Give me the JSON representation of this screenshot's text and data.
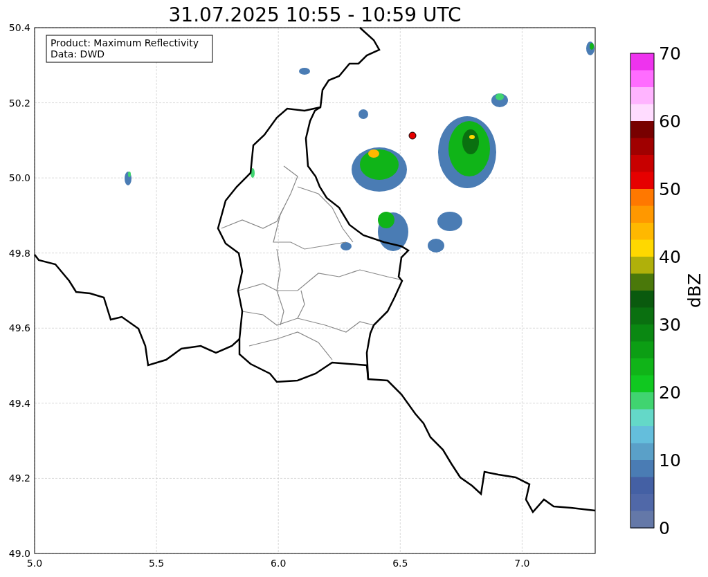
{
  "title": "31.07.2025 10:55 - 10:59 UTC",
  "info_box": {
    "lines": [
      "Product: Maximum Reflectivity",
      "Data: DWD"
    ]
  },
  "axes": {
    "xticks": [
      "5.0",
      "5.5",
      "6.0",
      "6.5",
      "7.0"
    ],
    "yticks": [
      "50.4",
      "50.2",
      "50.0",
      "49.8",
      "49.6",
      "49.4",
      "49.2",
      "49.0"
    ]
  },
  "colorbar": {
    "label": "dBZ",
    "ticks": [
      "70",
      "60",
      "50",
      "40",
      "30",
      "20",
      "10",
      "0"
    ],
    "bins": [
      {
        "color": "#ee33ee"
      },
      {
        "color": "#ff6cff"
      },
      {
        "color": "#ffb4ff"
      },
      {
        "color": "#ffdcff"
      },
      {
        "color": "#780000"
      },
      {
        "color": "#a00000"
      },
      {
        "color": "#c80000"
      },
      {
        "color": "#e60000"
      },
      {
        "color": "#ff7800"
      },
      {
        "color": "#ff9800"
      },
      {
        "color": "#ffb800"
      },
      {
        "color": "#ffd800"
      },
      {
        "color": "#b0b00a"
      },
      {
        "color": "#4a780a"
      },
      {
        "color": "#0a5a0e"
      },
      {
        "color": "#0a7010"
      },
      {
        "color": "#0a8812"
      },
      {
        "color": "#0c9e14"
      },
      {
        "color": "#10b418"
      },
      {
        "color": "#10c820"
      },
      {
        "color": "#40d470"
      },
      {
        "color": "#64d8c8"
      },
      {
        "color": "#64bedc"
      },
      {
        "color": "#5aa0c8"
      },
      {
        "color": "#4a7cb4"
      },
      {
        "color": "#4460a4"
      },
      {
        "color": "#5068a8"
      },
      {
        "color": "#6478a8"
      }
    ]
  }
}
